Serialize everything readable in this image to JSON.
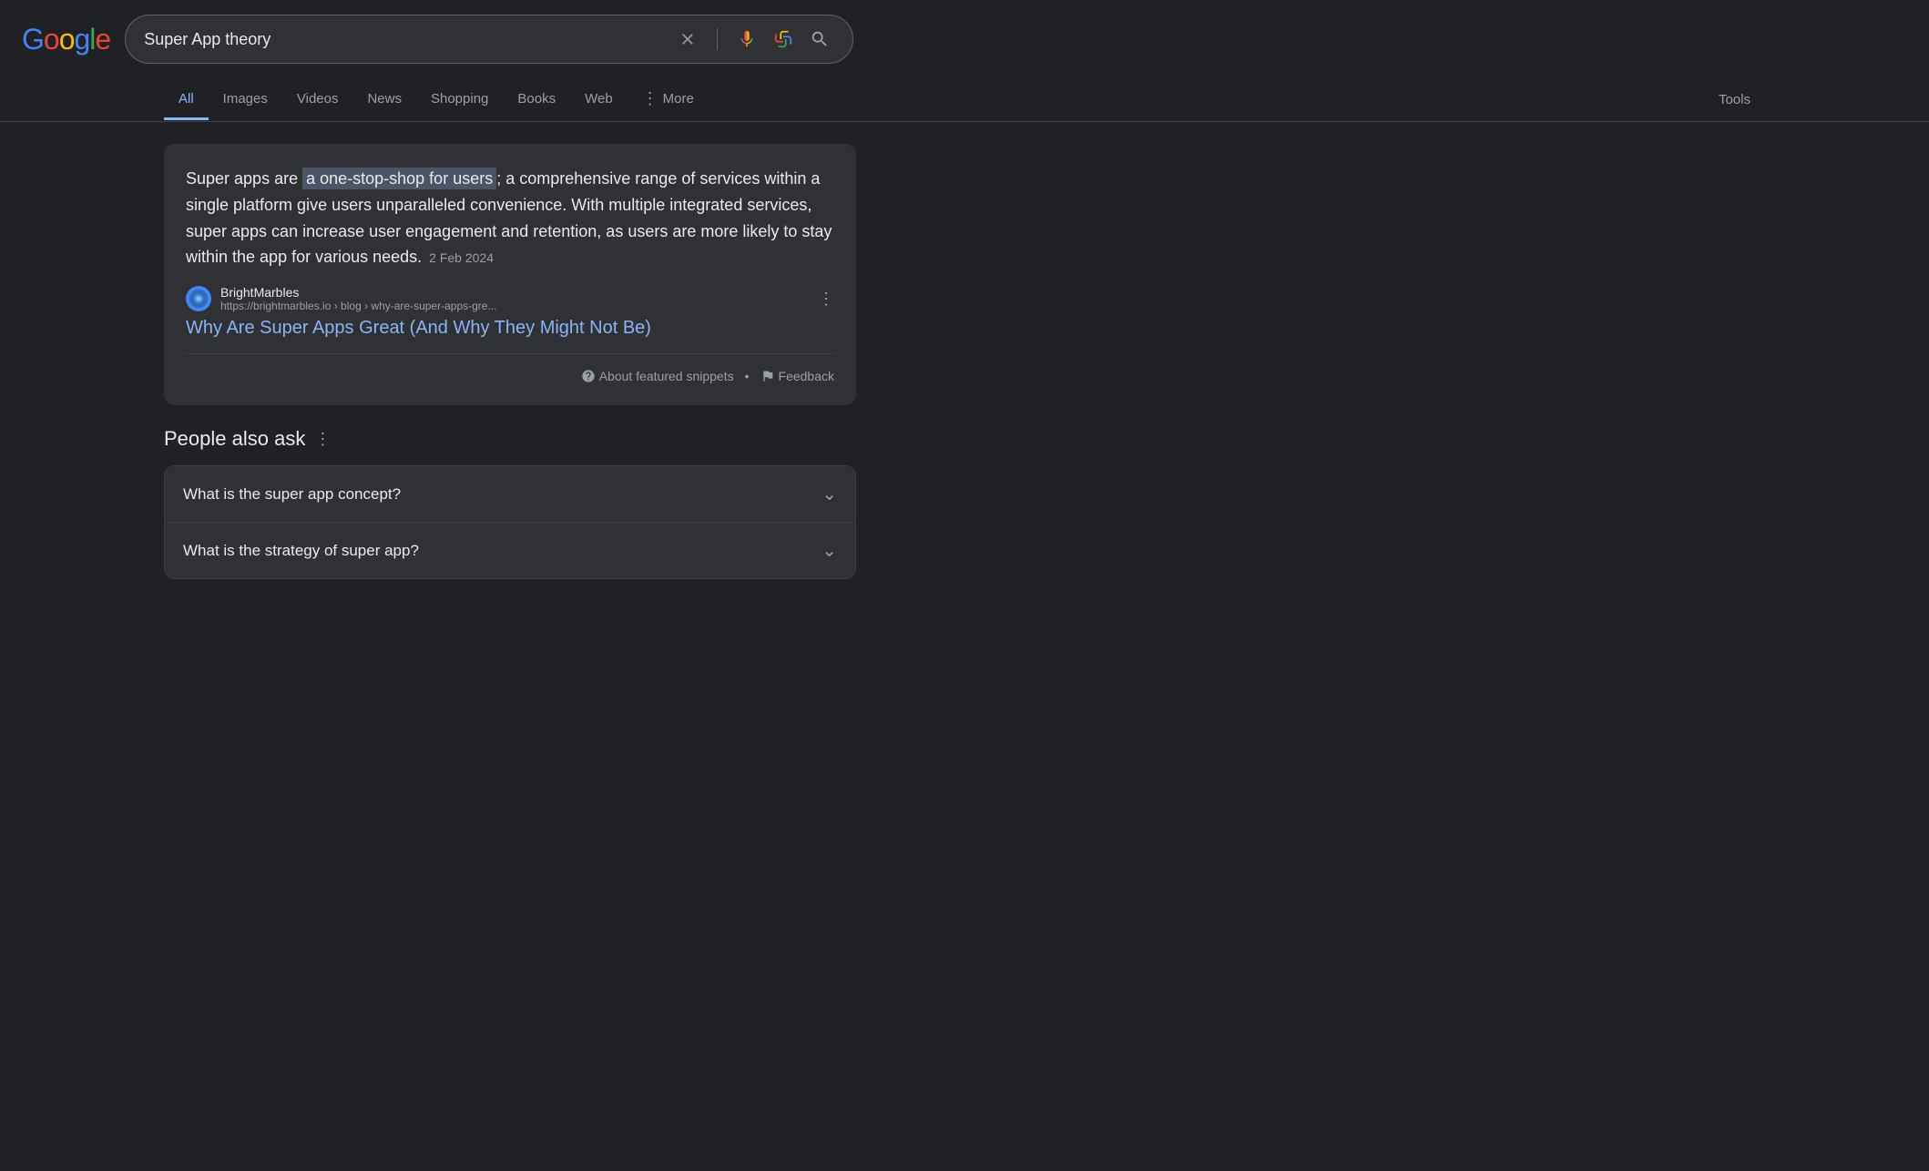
{
  "header": {
    "logo": "Google",
    "logo_letters": [
      {
        "char": "G",
        "color": "#4285f4"
      },
      {
        "char": "o",
        "color": "#ea4335"
      },
      {
        "char": "o",
        "color": "#fbbc05"
      },
      {
        "char": "g",
        "color": "#4285f4"
      },
      {
        "char": "l",
        "color": "#34a853"
      },
      {
        "char": "e",
        "color": "#ea4335"
      }
    ],
    "search_query": "Super App theory",
    "clear_label": "×"
  },
  "nav": {
    "tabs": [
      {
        "id": "all",
        "label": "All",
        "active": true
      },
      {
        "id": "images",
        "label": "Images",
        "active": false
      },
      {
        "id": "videos",
        "label": "Videos",
        "active": false
      },
      {
        "id": "news",
        "label": "News",
        "active": false
      },
      {
        "id": "shopping",
        "label": "Shopping",
        "active": false
      },
      {
        "id": "books",
        "label": "Books",
        "active": false
      },
      {
        "id": "web",
        "label": "Web",
        "active": false
      },
      {
        "id": "more",
        "label": "More",
        "active": false
      }
    ],
    "tools_label": "Tools"
  },
  "featured_snippet": {
    "text_before": "Super apps are ",
    "highlighted_text": "a one-stop-shop for users",
    "text_after": "; a comprehensive range of services within a single platform give users unparalleled convenience. With multiple integrated services, super apps can increase user engagement and retention, as users are more likely to stay within the app for various needs.",
    "date": "2 Feb 2024",
    "source_name": "BrightMarbles",
    "source_url": "https://brightmarbles.io › blog › why-are-super-apps-gre...",
    "result_title": "Why Are Super Apps Great (And Why They Might Not Be)",
    "about_snippets_label": "About featured snippets",
    "feedback_label": "Feedback"
  },
  "people_also_ask": {
    "section_title": "People also ask",
    "questions": [
      {
        "id": "q1",
        "text": "What is the super app concept?"
      },
      {
        "id": "q2",
        "text": "What is the strategy of super app?"
      }
    ]
  }
}
